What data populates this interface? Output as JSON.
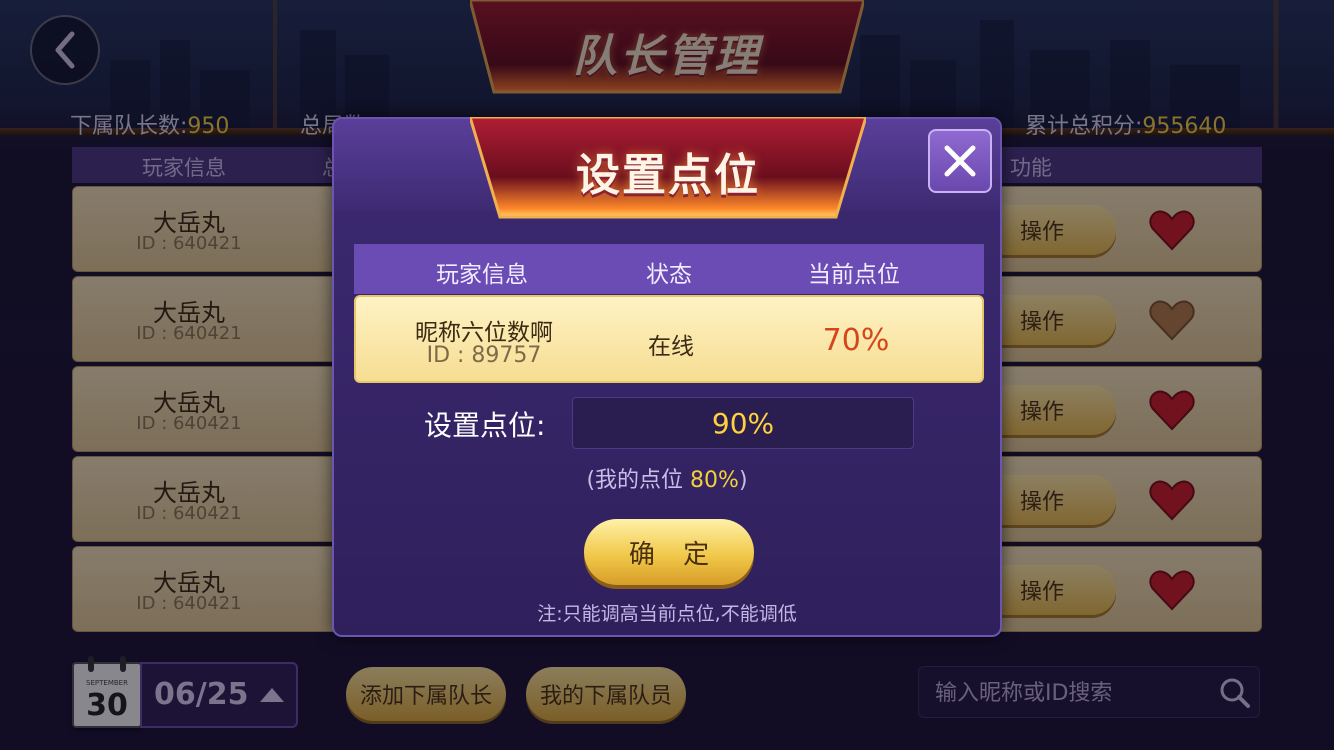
{
  "header": {
    "title": "队长管理",
    "stats": [
      {
        "label": "下属队长数:",
        "value": "950"
      },
      {
        "label": "总局数",
        "value": ""
      },
      {
        "label": "",
        "value": ""
      },
      {
        "label": "",
        "value": ""
      },
      {
        "label": "累计总积分:",
        "value": "955640"
      }
    ]
  },
  "table": {
    "columns": [
      "玩家信息",
      "总",
      "功能"
    ],
    "rows": [
      {
        "nick": "大岳丸",
        "id": "ID : 640421",
        "op": "操作",
        "heart": "red"
      },
      {
        "nick": "大岳丸",
        "id": "ID : 640421",
        "op": "操作",
        "heart": "brown"
      },
      {
        "nick": "大岳丸",
        "id": "ID : 640421",
        "op": "操作",
        "heart": "red"
      },
      {
        "nick": "大岳丸",
        "id": "ID : 640421",
        "op": "操作",
        "heart": "red"
      },
      {
        "nick": "大岳丸",
        "id": "ID : 640421",
        "op": "操作",
        "heart": "red"
      }
    ]
  },
  "footer": {
    "calendar_month": "SEPTEMBER",
    "calendar_day": "30",
    "date": "06/25",
    "add_leader": "添加下属队长",
    "my_members": "我的下属队员",
    "search_placeholder": "输入昵称或ID搜索"
  },
  "dialog": {
    "title": "设置点位",
    "columns": [
      "玩家信息",
      "状态",
      "当前点位"
    ],
    "player": {
      "nick": "昵称六位数啊",
      "id": "ID : 89757",
      "status": "在线",
      "point": "70%"
    },
    "set_label": "设置点位:",
    "set_value": "90%",
    "my_point_prefix": "(我的点位 ",
    "my_point_value": "80%",
    "my_point_suffix": ")",
    "confirm": "确 定",
    "note": "注:只能调高当前点位,不能调低"
  },
  "colors": {
    "accent_gold": "#f4cf3a",
    "current_point_red": "#d4461c",
    "dialog_purple": "#3d2a72",
    "heart_red": "#c81e28",
    "heart_brown": "#b07a45"
  }
}
